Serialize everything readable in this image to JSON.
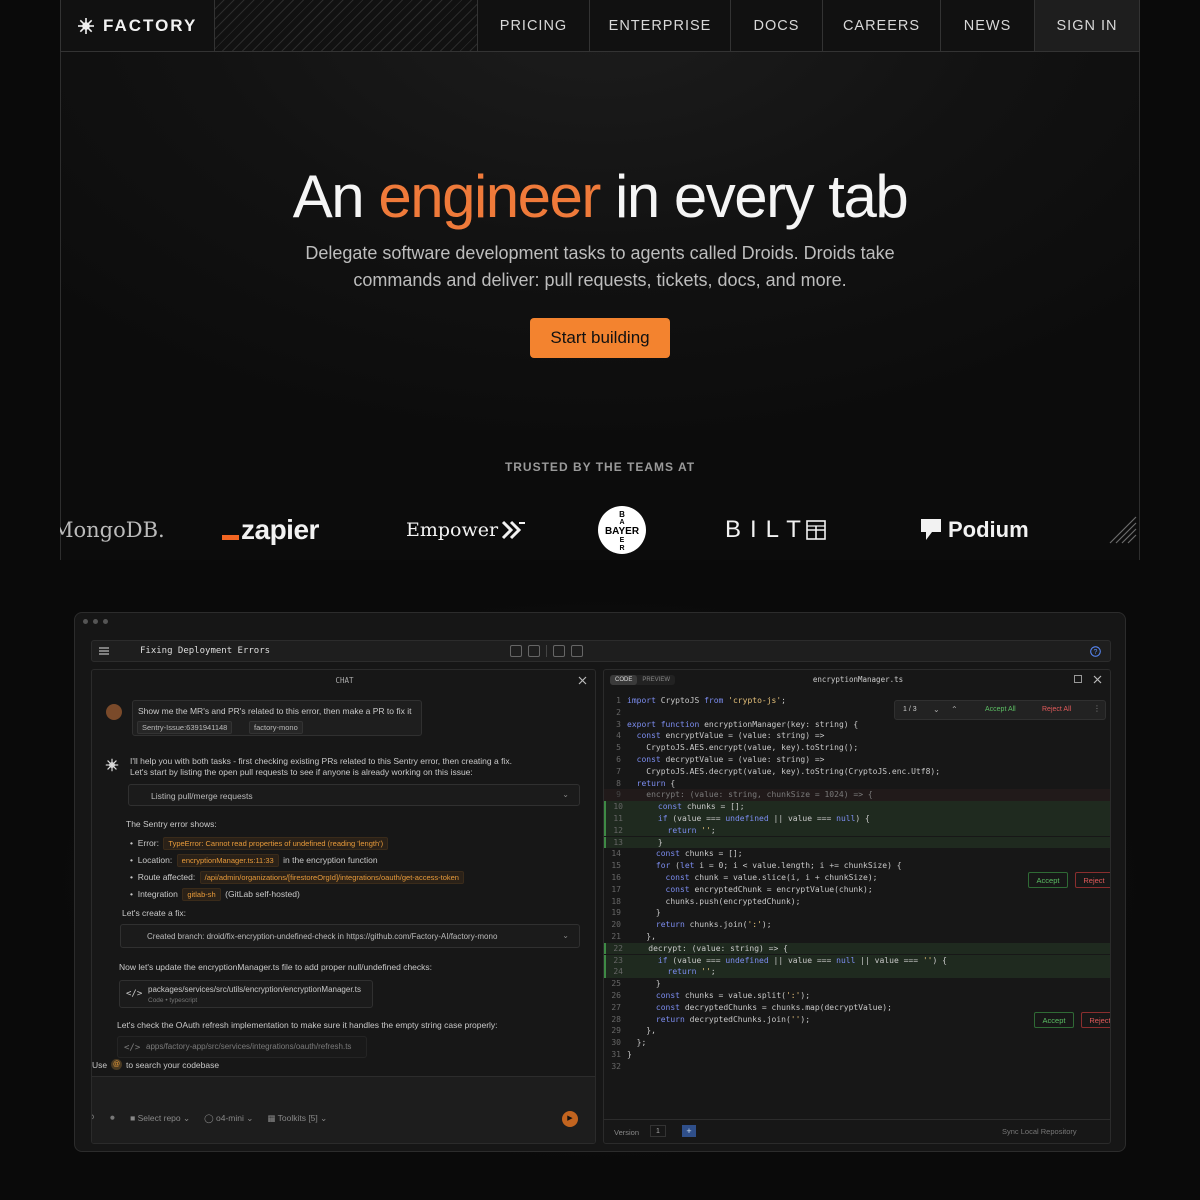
{
  "nav": {
    "brand": "FACTORY",
    "items": [
      "PRICING",
      "ENTERPRISE",
      "DOCS",
      "CAREERS",
      "NEWS",
      "SIGN IN"
    ]
  },
  "hero": {
    "headline_pre": "An ",
    "headline_accent": "engineer",
    "headline_post": " in every tab",
    "subhead": "Delegate software development tasks to agents called Droids. Droids take commands and deliver: pull requests, tickets, docs, and more.",
    "cta": "Start building"
  },
  "trusted": {
    "label": "TRUSTED BY THE TEAMS AT",
    "logos": [
      "MongoDB.",
      "zapier",
      "Empower",
      "BAYER",
      "BILT",
      "Podium"
    ]
  },
  "app": {
    "title": "Fixing Deployment Errors",
    "chat": {
      "header": "CHAT",
      "user_message": "Show me the MR's and PR's related to this error, then make a PR to fix it",
      "user_chips": [
        "Sentry-Issue:6391941148",
        "factory-mono"
      ],
      "reply_1": "I'll help you with both tasks - first checking existing PRs related to this Sentry error, then creating a fix.",
      "reply_2": "Let's start by listing the open pull requests to see if anyone is already working on this issue:",
      "tool_1": "Listing pull/merge requests",
      "sentry_heading": "The Sentry error shows:",
      "bullets": [
        {
          "label": "Error:",
          "chip": "TypeError: Cannot read properties of undefined (reading 'length')",
          "after": ""
        },
        {
          "label": "Location:",
          "chip": "encryptionManager.ts:11:33",
          "after": "in the encryption function"
        },
        {
          "label": "Route affected:",
          "chip": "/api/admin/organizations/[firestoreOrgId]/integrations/oauth/get-access-token",
          "after": ""
        },
        {
          "label": "Integration",
          "chip": "gitlab-sh",
          "after": "(GitLab self-hosted)"
        }
      ],
      "fix_heading": "Let's create a fix:",
      "tool_2": "Created branch: droid/fix-encryption-undefined-check in https://github.com/Factory-AI/factory-mono",
      "update_text": "Now let's update the encryptionManager.ts file to add proper null/undefined checks:",
      "file_path": "packages/services/src/utils/encryption/encryptionManager.ts",
      "file_meta": "Code • typescript",
      "oauth_text": "Let's check the OAuth refresh implementation to make sure it handles the empty string case properly:",
      "file_path_2": "apps/factory-app/src/services/integrations/oauth/refresh.ts",
      "hint_pre": "Use",
      "hint_post": "to search your codebase",
      "toolbar": [
        "Select repo",
        "o4-mini",
        "Toolkits [5]"
      ]
    },
    "code": {
      "tabs": [
        "CODE",
        "PREVIEW"
      ],
      "filename": "encryptionManager.ts",
      "diff_counter": "1 / 3",
      "accept_all": "Accept All",
      "reject_all": "Reject All",
      "accept": "Accept",
      "reject": "Reject",
      "version_label": "Version",
      "version_value": "1",
      "sync": "Sync Local Repository",
      "lines": [
        "import CryptoJS from 'crypto-js';",
        "",
        "export function encryptionManager(key: string) {",
        "  const encryptValue = (value: string) =>",
        "    CryptoJS.AES.encrypt(value, key).toString();",
        "  const decryptValue = (value: string) =>",
        "    CryptoJS.AES.decrypt(value, key).toString(CryptoJS.enc.Utf8);",
        "  return {",
        "    encrypt: (value: string, chunkSize = 1024) => {",
        "      const chunks = [];",
        "      if (value === undefined || value === null) {",
        "        return '';",
        "      }",
        "      const chunks = [];",
        "      for (let i = 0; i < value.length; i += chunkSize) {",
        "        const chunk = value.slice(i, i + chunkSize);",
        "        const encryptedChunk = encryptValue(chunk);",
        "        chunks.push(encryptedChunk);",
        "      }",
        "      return chunks.join(':');",
        "    },",
        "    decrypt: (value: string) => {",
        "      if (value === undefined || value === null || value === '') {",
        "        return '';",
        "      }",
        "      const chunks = value.split(':');",
        "      const decryptedChunks = chunks.map(decryptValue);",
        "      return decryptedChunks.join('');",
        "    },",
        "  };",
        "}",
        ""
      ]
    }
  }
}
